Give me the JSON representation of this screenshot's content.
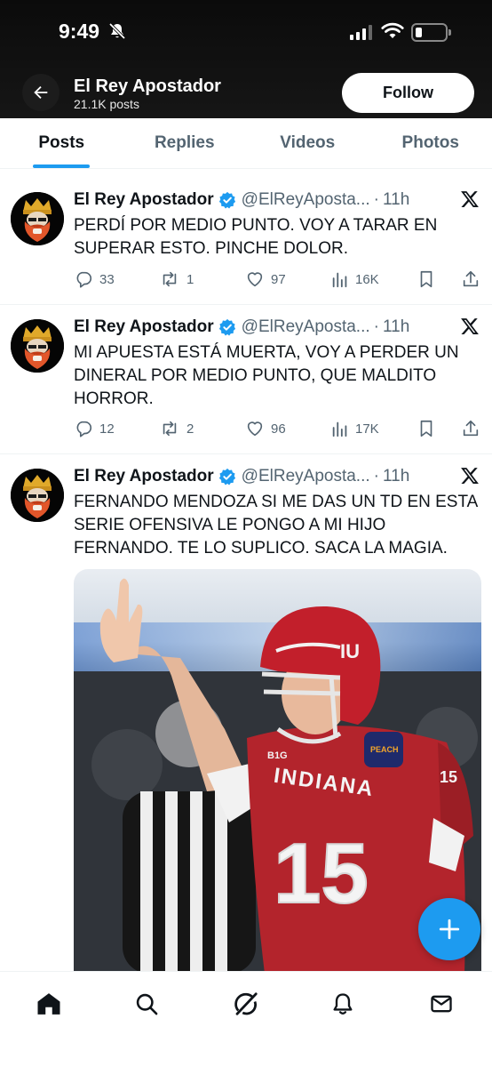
{
  "status_bar": {
    "time": "9:49",
    "icons": [
      "bell-off-icon",
      "signal-icon",
      "wifi-icon",
      "battery-icon"
    ]
  },
  "header": {
    "profile_name": "El Rey Apostador",
    "post_count": "21.1K posts",
    "follow_label": "Follow",
    "back_icon": "arrow-left-icon"
  },
  "tabs": [
    {
      "label": "Posts",
      "active": true
    },
    {
      "label": "Replies",
      "active": false
    },
    {
      "label": "Videos",
      "active": false
    },
    {
      "label": "Photos",
      "active": false
    }
  ],
  "tweets": [
    {
      "name": "El Rey Apostador",
      "handle": "@ElReyAposta...",
      "time": "11h",
      "text": "PERDÍ POR MEDIO PUNTO. VOY A TARAR EN SUPERAR ESTO. PINCHE DOLOR.",
      "replies": "33",
      "reposts": "1",
      "likes": "97",
      "views": "16K"
    },
    {
      "name": "El Rey Apostador",
      "handle": "@ElReyAposta...",
      "time": "11h",
      "text": "MI APUESTA ESTÁ MUERTA, VOY A PERDER UN DINERAL POR MEDIO PUNTO, QUE MALDITO HORROR.",
      "replies": "12",
      "reposts": "2",
      "likes": "96",
      "views": "17K"
    },
    {
      "name": "El Rey Apostador",
      "handle": "@ElReyAposta...",
      "time": "11h",
      "text": "FERNANDO MENDOZA SI ME DAS UN TD EN ESTA SERIE OFENSIVA LE PONGO A MI HIJO FERNANDO. TE LO SUPLICO. SACA LA MAGIA.",
      "media": {
        "jersey_text": "INDIANA",
        "jersey_number": "15",
        "collar_text": "B1G",
        "helmet_logo": "IU",
        "patch_text": "PEACH"
      }
    }
  ],
  "bottom_nav": [
    "home-icon",
    "search-icon",
    "grok-icon",
    "notifications-icon",
    "messages-icon"
  ],
  "colors": {
    "accent": "#1d9bf0",
    "text": "#0f1419",
    "secondary": "#536471",
    "header_bg": "#0b0b0b",
    "jersey": "#b3242c"
  }
}
